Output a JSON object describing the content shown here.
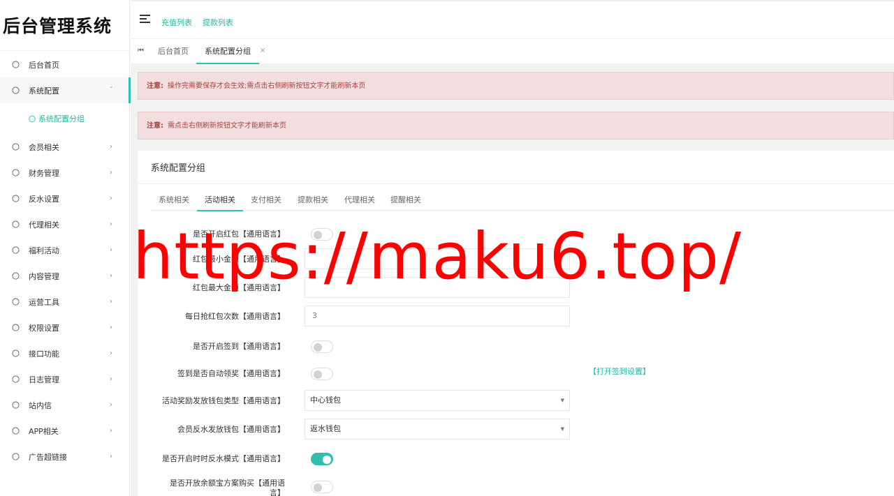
{
  "app": {
    "title": "后台管理系统"
  },
  "sidebar": {
    "items": [
      {
        "label": "后台首页",
        "icon": "circle-icon"
      },
      {
        "label": "系统配置",
        "icon": "circle-icon",
        "expanded": true
      },
      {
        "label": "会员相关",
        "icon": "circle-icon"
      },
      {
        "label": "财务管理",
        "icon": "circle-icon"
      },
      {
        "label": "反水设置",
        "icon": "circle-icon"
      },
      {
        "label": "代理相关",
        "icon": "circle-icon"
      },
      {
        "label": "福利活动",
        "icon": "circle-icon"
      },
      {
        "label": "内容管理",
        "icon": "circle-icon"
      },
      {
        "label": "运营工具",
        "icon": "circle-icon"
      },
      {
        "label": "权限设置",
        "icon": "circle-icon"
      },
      {
        "label": "接口功能",
        "icon": "circle-icon"
      },
      {
        "label": "日志管理",
        "icon": "circle-icon"
      },
      {
        "label": "站内信",
        "icon": "circle-icon"
      },
      {
        "label": "APP相关",
        "icon": "circle-icon"
      },
      {
        "label": "广告超链接",
        "icon": "circle-icon"
      }
    ],
    "sub_item": {
      "label": "系统配置分组"
    }
  },
  "topbar": {
    "links": [
      "充值列表",
      "提款列表"
    ]
  },
  "tabs": {
    "items": [
      "后台首页",
      "系统配置分组"
    ],
    "close": "×",
    "prev": "⏮"
  },
  "alerts": [
    {
      "prefix": "注意:",
      "text": "操作完需要保存才会生效;需点击右侧刷新按钮文字才能刷新本页"
    },
    {
      "prefix": "注意:",
      "text": "需点击右侧刷新按钮文字才能刷新本页"
    }
  ],
  "panel": {
    "title": "系统配置分组",
    "sections": [
      "系统相关",
      "活动相关",
      "支付相关",
      "提款相关",
      "代理相关",
      "提醒相关"
    ],
    "active_section": "活动相关"
  },
  "form": {
    "fields": [
      {
        "label": "是否开启红包【通用语言】",
        "type": "switch",
        "on": false
      },
      {
        "label": "红包最小金额【通用语言】",
        "type": "input",
        "value": ""
      },
      {
        "label": "红包最大金额【通用语言】",
        "type": "input",
        "value": ""
      },
      {
        "label": "每日抢红包次数【通用语言】",
        "type": "input",
        "value": "3"
      },
      {
        "label": "是否开启签到【通用语言】",
        "type": "switch",
        "on": false
      },
      {
        "label": "签到是否自动领奖【通用语言】",
        "type": "switch",
        "on": false,
        "link": "【打开签到设置】"
      },
      {
        "label": "活动奖励发放钱包类型【通用语言】",
        "type": "select",
        "value": "中心钱包"
      },
      {
        "label": "会员反水发放钱包【通用语言】",
        "type": "select",
        "value": "返水钱包"
      },
      {
        "label": "是否开启时时反水模式【通用语言】",
        "type": "switch",
        "on": true
      },
      {
        "label": "是否开放余额宝方案购买【通用语言】",
        "type": "switch",
        "on": false
      }
    ]
  },
  "watermark": {
    "text": "https://maku6.top/",
    "color": "#ff0000"
  },
  "colors": {
    "accent": "#2ebfae",
    "alert_bg": "#f2dede",
    "alert_text": "#a94442"
  }
}
